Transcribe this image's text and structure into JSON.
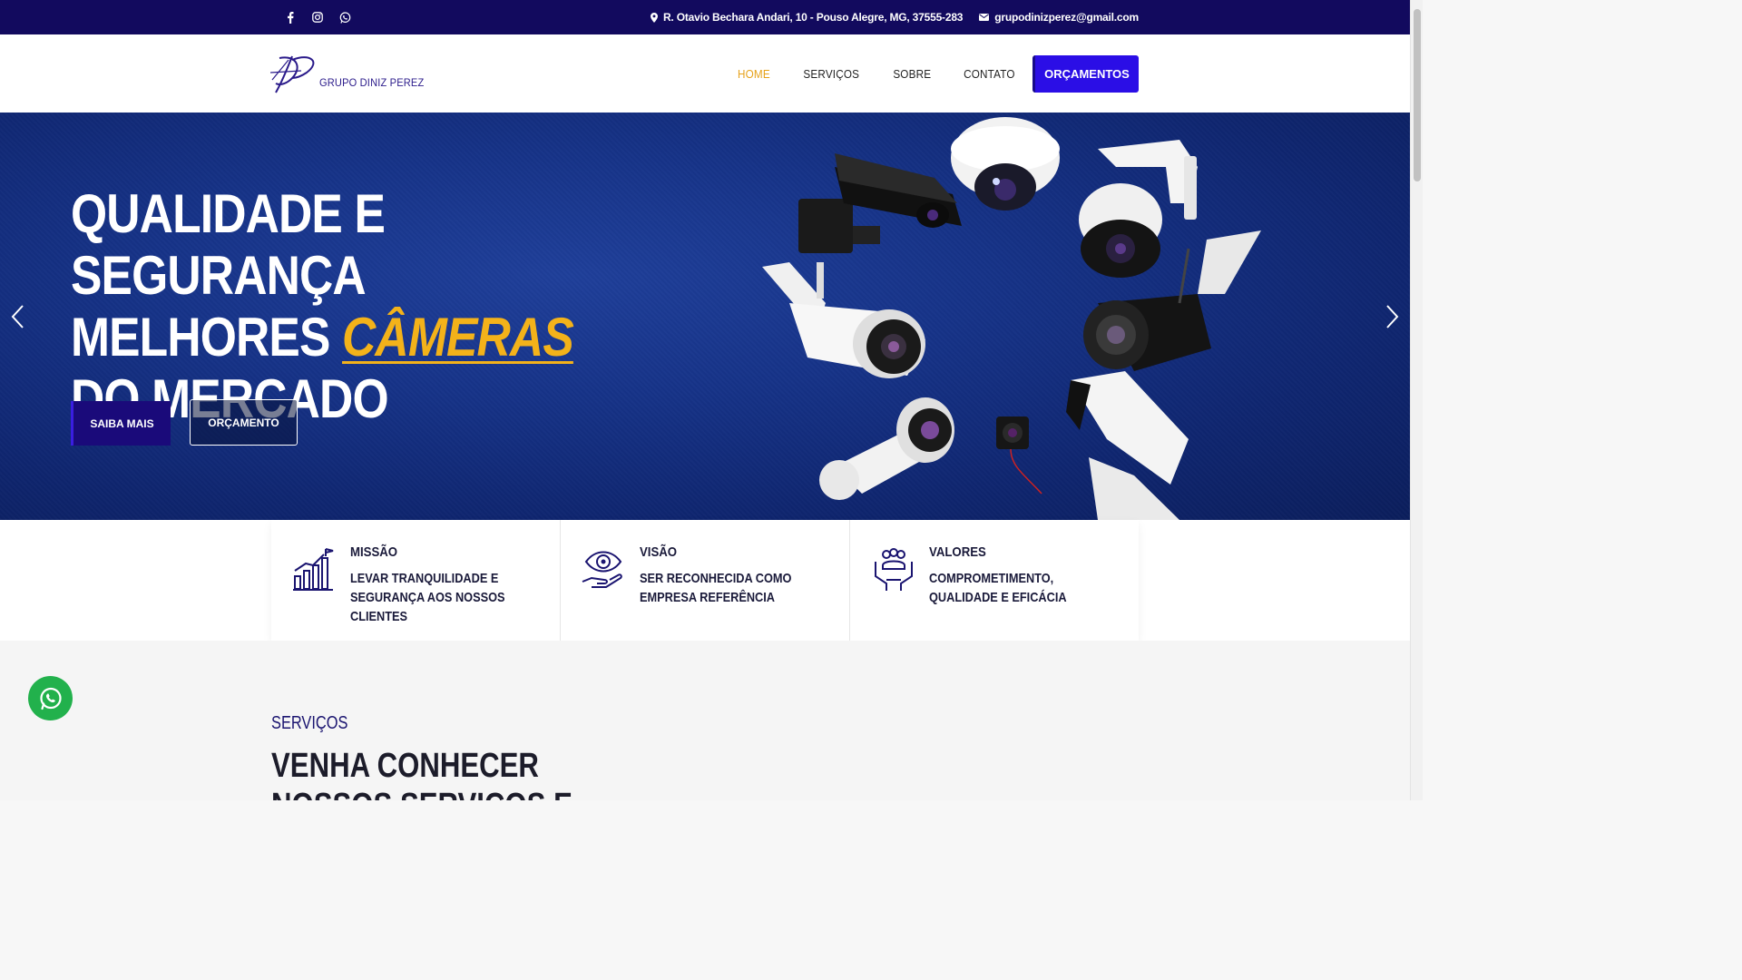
{
  "topbar": {
    "social": [
      "facebook-icon",
      "instagram-icon",
      "whatsapp-icon"
    ],
    "address": "R. Otavio Bechara Andari, 10 - Pouso Alegre, MG, 37555-283",
    "email": "grupodinizperez@gmail.com"
  },
  "header": {
    "brand": "GRUPO DINIZ PEREZ",
    "nav": [
      "HOME",
      "SERVIÇOS",
      "SOBRE",
      "CONTATO"
    ],
    "cta": "ORÇAMENTOS"
  },
  "hero": {
    "line1": "QUALIDADE E SEGURANÇA",
    "line2_prefix": "MELHORES ",
    "line2_accent": "CÂMERAS",
    "line3": "DO MERCADO",
    "primary_button": "SAIBA MAIS",
    "secondary_button": "ORÇAMENTO"
  },
  "features": [
    {
      "icon": "growth-chart-icon",
      "title": "MISSÃO",
      "text": "LEVAR TRANQUILIDADE E SEGURANÇA AOS NOSSOS CLIENTES"
    },
    {
      "icon": "eye-hand-icon",
      "title": "VISÃO",
      "text": "SER RECONHECIDA COMO EMPRESA REFERÊNCIA"
    },
    {
      "icon": "team-hands-icon",
      "title": "VALORES",
      "text": "COMPROMETIMENTO, QUALIDADE E EFICÁCIA"
    }
  ],
  "services": {
    "kicker": "SERVIÇOS",
    "heading_line1": "VENHA CONHECER",
    "heading_line2": "NOSSOS SERVIÇOS E PRODUTOS"
  },
  "colors": {
    "topbar": "#120a5e",
    "accent": "#f3b21a",
    "cta": "#2b0ee6",
    "whatsapp": "#22b14c"
  }
}
